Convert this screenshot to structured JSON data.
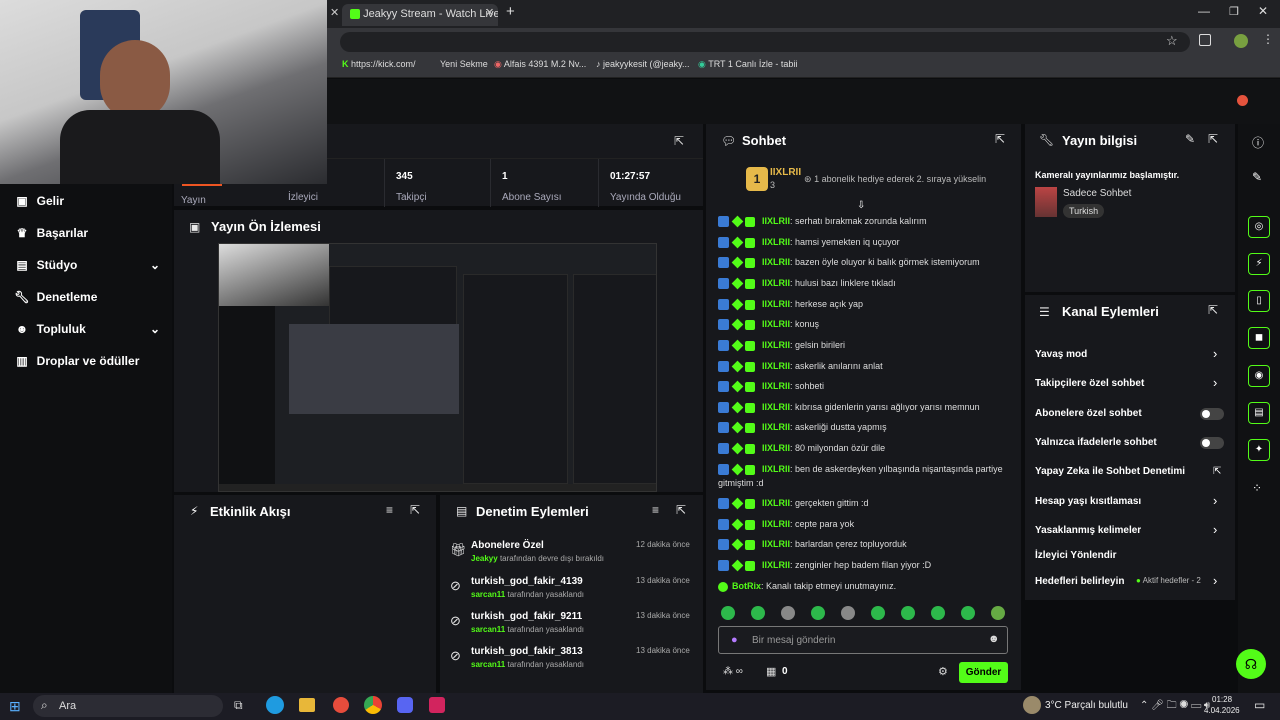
{
  "browser": {
    "tab_title": "Jeakyy Stream - Watch Live on",
    "bookmarks": [
      "https://kick.com/",
      "Yeni Sekme",
      "Alfais 4391 M.2 Nv...",
      "jeakyykesit (@jeaky...",
      "TRT 1 Canlı İzle - tabii"
    ]
  },
  "stats": [
    {
      "label": "Yayın"
    },
    {
      "label": "İzleyici"
    },
    {
      "value": "345",
      "label": "Takipçi"
    },
    {
      "value": "1",
      "label": "Abone Sayısı"
    },
    {
      "value": "01:27:57",
      "label": "Yayında Olduğu"
    }
  ],
  "sidebar": {
    "items": [
      {
        "label": "Gelir",
        "icon": "wallet-icon"
      },
      {
        "label": "Başarılar",
        "icon": "trophy-icon"
      },
      {
        "label": "Stüdyo",
        "icon": "layout-icon",
        "expand": true
      },
      {
        "label": "Denetleme",
        "icon": "wrench-icon"
      },
      {
        "label": "Topluluk",
        "icon": "users-icon",
        "expand": true
      },
      {
        "label": "Droplar ve ödüller",
        "icon": "chart-icon"
      }
    ]
  },
  "preview": {
    "title": "Yayın Ön İzlemesi"
  },
  "activity": {
    "title": "Etkinlik Akışı"
  },
  "mod_actions": {
    "title": "Denetim Eylemleri",
    "items": [
      {
        "title": "Abonelere Özel",
        "actor": "Jeakyy",
        "desc": "tarafından devre dışı bırakıldı",
        "time": "12 dakika önce"
      },
      {
        "title": "turkish_god_fakir_4139",
        "actor": "sarcan11",
        "desc": "tarafından yasaklandı",
        "time": "13 dakika önce"
      },
      {
        "title": "turkish_god_fakir_9211",
        "actor": "sarcan11",
        "desc": "tarafından yasaklandı",
        "time": "13 dakika önce"
      },
      {
        "title": "turkish_god_fakir_3813",
        "actor": "sarcan11",
        "desc": "tarafından yasaklandı",
        "time": "13 dakika önce"
      }
    ]
  },
  "chat": {
    "title": "Sohbet",
    "leader": {
      "rank": "1",
      "name": "IIXLRII",
      "count": "3",
      "note": "1 abonelik hediye ederek 2. sıraya yükselin"
    },
    "messages": [
      {
        "user": "IIXLRII",
        "text": "serhatı bırakmak zorunda kalırım"
      },
      {
        "user": "IIXLRII",
        "text": "hamsi yemekten iq uçuyor"
      },
      {
        "user": "IIXLRII",
        "text": "bazen öyle oluyor ki balık görmek istemiyorum"
      },
      {
        "user": "IIXLRII",
        "text": "hulusi bazı linklere tıkladı"
      },
      {
        "user": "IIXLRII",
        "text": "herkese açık yap"
      },
      {
        "user": "IIXLRII",
        "text": "konuş"
      },
      {
        "user": "IIXLRII",
        "text": "gelsin birileri"
      },
      {
        "user": "IIXLRII",
        "text": "askerlik anılarını anlat"
      },
      {
        "user": "IIXLRII",
        "text": "sohbeti"
      },
      {
        "user": "IIXLRII",
        "text": "kıbrısa gidenlerin yarısı ağlıyor yarısı memnun"
      },
      {
        "user": "IIXLRII",
        "text": "askerliği dustta yapmış"
      },
      {
        "user": "IIXLRII",
        "text": "80 milyondan özür dile"
      },
      {
        "user": "IIXLRII",
        "text": "ben de askerdeyken yılbaşında nişantaşında partiye"
      },
      {
        "user": "",
        "text": "gitmiştim :d"
      },
      {
        "user": "IIXLRII",
        "text": "gerçekten gittim :d"
      },
      {
        "user": "IIXLRII",
        "text": "cepte para yok"
      },
      {
        "user": "IIXLRII",
        "text": "barlardan çerez topluyorduk"
      },
      {
        "user": "IIXLRII",
        "text": "zenginler hep badem filan yiyor :D"
      },
      {
        "user": "BotRix",
        "text": "Kanalı takip etmeyi unutmayınız."
      }
    ],
    "placeholder": "Bir mesaj gönderin",
    "points": "0",
    "send_label": "Gönder"
  },
  "stream_info": {
    "title": "Yayın bilgisi",
    "stream_title": "Kameralı yayınlarımız başlamıştır.",
    "category": "Sadece Sohbet",
    "tag": "Turkish"
  },
  "channel_actions": {
    "title": "Kanal Eylemleri",
    "items": [
      {
        "label": "Yavaş mod",
        "control": "chevron"
      },
      {
        "label": "Takipçilere özel sohbet",
        "control": "chevron"
      },
      {
        "label": "Abonelere özel sohbet",
        "control": "toggle"
      },
      {
        "label": "Yalnızca ifadelerle sohbet",
        "control": "toggle"
      },
      {
        "label": "Yapay Zeka ile Sohbet Denetimi",
        "control": "external"
      },
      {
        "label": "Hesap yaşı kısıtlaması",
        "control": "chevron"
      },
      {
        "label": "Yasaklanmış kelimeler",
        "control": "chevron"
      },
      {
        "label": "İzleyici Yönlendir",
        "control": "none"
      },
      {
        "label": "Hedefleri belirleyin",
        "control": "chevron",
        "extra": "Aktif hedefler - 2"
      }
    ]
  },
  "taskbar": {
    "search": "Ara",
    "weather": "3°C  Parçalı bulutlu",
    "time": "01:28",
    "date": "4.04.2026"
  },
  "colors": {
    "accent": "#53fc18",
    "panel": "#17181c",
    "bg": "#0b0c0e"
  }
}
